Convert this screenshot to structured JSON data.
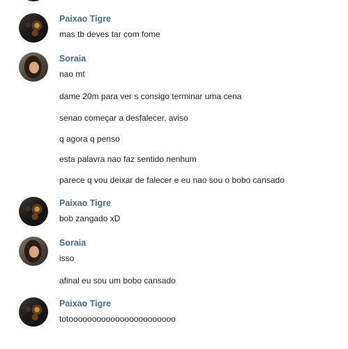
{
  "chat": {
    "groups": [
      {
        "author": "Paixao Tigre",
        "messages": [
          "mas tb deves tar com fome"
        ]
      },
      {
        "author": "Soraia",
        "messages": [
          "nao mt",
          "dame 20m para ver s consigo terminar uma cena",
          "senao começar a desfalecer, aviso",
          "q agora q penso",
          "esta palavra nao faz sentido nenhum",
          "parece q vou deixar de falecer e eu nao sou o bobo cansado"
        ]
      },
      {
        "author": "Paixao Tigre",
        "messages": [
          "bob zangado xD"
        ]
      },
      {
        "author": "Soraia",
        "messages": [
          "isso",
          "afinal eu sou um bobo cansado"
        ]
      },
      {
        "author": "Paixao Tigre",
        "messages": [
          "totooooooooooooooooooooooo"
        ]
      }
    ]
  },
  "colors": {
    "author_name": "#456c8f",
    "message_text": "#1d1d1d",
    "background": "#ffffff"
  }
}
